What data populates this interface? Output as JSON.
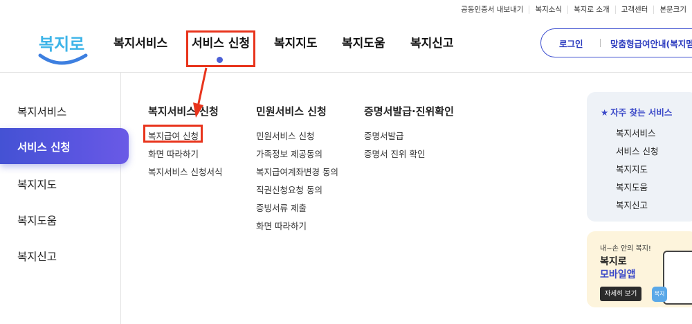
{
  "utility": [
    "공동인증서 내보내기",
    "복지소식",
    "복지로 소개",
    "고객센터",
    "본문크기"
  ],
  "logo": {
    "text": "복지로",
    "accent": "#3db4e8"
  },
  "gnb": {
    "items": [
      "복지서비스",
      "서비스 신청",
      "복지지도",
      "복지도움",
      "복지신고"
    ],
    "active_index": 1
  },
  "login": {
    "login_label": "로그인",
    "info_label": "맞춤형급여안내(복지멤"
  },
  "side": {
    "items": [
      "복지서비스",
      "서비스 신청",
      "복지지도",
      "복지도움",
      "복지신고"
    ],
    "active_index": 1
  },
  "submenu": [
    {
      "title": "복지서비스 신청",
      "links": [
        "복지급여 신청",
        "화면 따라하기",
        "복지서비스 신청서식"
      ]
    },
    {
      "title": "민원서비스 신청",
      "links": [
        "민원서비스 신청",
        "가족정보 제공동의",
        "복지급여계좌변경 동의",
        "직권신청요청 동의",
        "증빙서류 제출",
        "화면 따라하기"
      ]
    },
    {
      "title": "증명서발급·진위확인",
      "links": [
        "증명서발급",
        "증명서 진위 확인"
      ]
    }
  ],
  "quick": {
    "title": "자주 찾는 서비스",
    "items": [
      "복지서비스",
      "서비스 신청",
      "복지지도",
      "복지도움",
      "복지신고"
    ]
  },
  "app_banner": {
    "small": "내~손 안의 복지!",
    "title1": "복지로",
    "title2": "모바일앱",
    "button": "자세히 보기"
  },
  "colors": {
    "brand": "#4452d4",
    "highlight": "#e8341c",
    "quick_bg": "#eef2f7",
    "app_bg": "#fdf4dc"
  }
}
